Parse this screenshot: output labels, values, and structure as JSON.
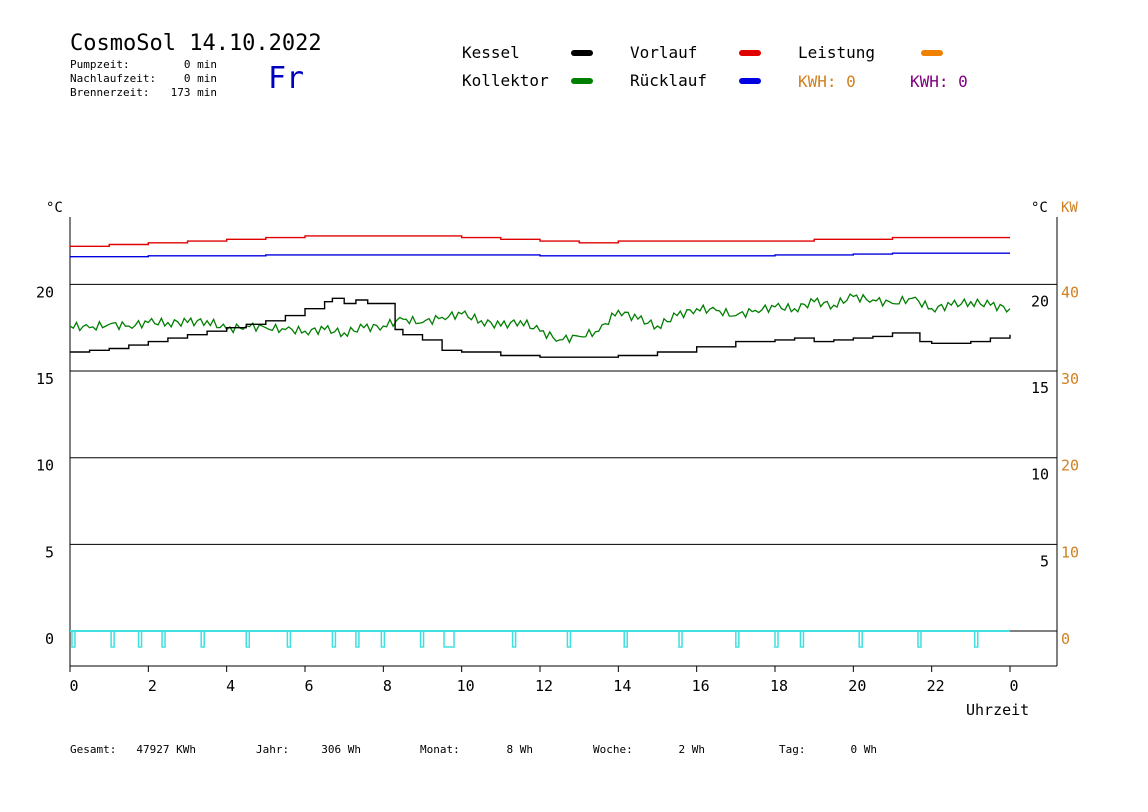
{
  "header": {
    "title": "CosmoSol 14.10.2022",
    "weekday": "Fr",
    "stats": [
      {
        "label": "Pumpzeit:",
        "value": "0 min"
      },
      {
        "label": "Nachlaufzeit:",
        "value": "0 min"
      },
      {
        "label": "Brennerzeit:",
        "value": "173 min"
      }
    ]
  },
  "legend": [
    {
      "label": "Kessel",
      "color": "#000000"
    },
    {
      "label": "Kollektor",
      "color": "#007f00"
    },
    {
      "label": "Vorlauf",
      "color": "#e00000"
    },
    {
      "label": "Rücklauf",
      "color": "#0000e0"
    },
    {
      "label": "Leistung",
      "color": "#f08000"
    }
  ],
  "kwh": [
    {
      "text": "KWH: 0",
      "color": "#d08020"
    },
    {
      "text": "KWH: 0",
      "color": "#800080"
    }
  ],
  "axis_units": {
    "left": "°C",
    "right_temp": "°C",
    "right_power": "KW"
  },
  "footer": [
    {
      "label": "Gesamt:",
      "value": "47927 KWh"
    },
    {
      "label": "Jahr:",
      "value": "306 Wh"
    },
    {
      "label": "Monat:",
      "value": "8 Wh"
    },
    {
      "label": "Woche:",
      "value": "2 Wh"
    },
    {
      "label": "Tag:",
      "value": "0 Wh"
    }
  ],
  "chart_data": {
    "type": "line",
    "xlabel": "Uhrzeit",
    "x_ticks": [
      "0",
      "2",
      "4",
      "6",
      "8",
      "10",
      "12",
      "14",
      "16",
      "18",
      "20",
      "22",
      "0"
    ],
    "xlim": [
      0,
      24
    ],
    "ylim": [
      -2,
      24
    ],
    "left_ticks": [
      "0",
      "5",
      "10",
      "15",
      "20"
    ],
    "left_tick_values": [
      0,
      5,
      10,
      15,
      20
    ],
    "right_temp_ticks": [
      "5",
      "10",
      "15",
      "20"
    ],
    "right_temp_values": [
      5,
      10,
      15,
      20
    ],
    "power_ticks": [
      "0",
      "10",
      "20",
      "30",
      "40"
    ],
    "power_tick_values": [
      0,
      10,
      20,
      30,
      40
    ],
    "grid": true,
    "series": [
      {
        "name": "Vorlauf",
        "color": "#e00000",
        "x": [
          0,
          1,
          2,
          3,
          4,
          5,
          6,
          7,
          8,
          9,
          10,
          11,
          12,
          13,
          14,
          15,
          16,
          17,
          18,
          19,
          20,
          21,
          22,
          23,
          24
        ],
        "y": [
          22.2,
          22.3,
          22.4,
          22.5,
          22.6,
          22.7,
          22.8,
          22.8,
          22.8,
          22.8,
          22.7,
          22.6,
          22.5,
          22.4,
          22.5,
          22.5,
          22.5,
          22.5,
          22.5,
          22.6,
          22.6,
          22.7,
          22.7,
          22.7,
          22.7
        ]
      },
      {
        "name": "Rücklauf",
        "color": "#0000e0",
        "x": [
          0,
          1,
          2,
          3,
          4,
          5,
          6,
          7,
          8,
          9,
          10,
          11,
          12,
          13,
          14,
          15,
          16,
          17,
          18,
          19,
          20,
          21,
          22,
          23,
          24
        ],
        "y": [
          21.6,
          21.6,
          21.65,
          21.65,
          21.65,
          21.7,
          21.7,
          21.7,
          21.7,
          21.7,
          21.7,
          21.7,
          21.65,
          21.65,
          21.65,
          21.65,
          21.65,
          21.65,
          21.7,
          21.7,
          21.75,
          21.8,
          21.8,
          21.8,
          21.8
        ]
      },
      {
        "name": "Kollektor",
        "color": "#007f00",
        "x": [
          0,
          0.5,
          1,
          1.5,
          2,
          2.5,
          3,
          3.5,
          4,
          4.5,
          5,
          5.5,
          6,
          6.5,
          7,
          7.5,
          8,
          8.5,
          9,
          9.5,
          10,
          10.5,
          11,
          11.5,
          12,
          12.5,
          13,
          13.5,
          14,
          14.5,
          15,
          15.5,
          16,
          16.5,
          17,
          17.5,
          18,
          18.5,
          19,
          19.5,
          20,
          20.5,
          21,
          21.5,
          22,
          22.5,
          23,
          23.5,
          24
        ],
        "y": [
          17.6,
          17.5,
          17.7,
          17.6,
          17.8,
          17.8,
          17.8,
          17.9,
          17.4,
          17.6,
          17.5,
          17.4,
          17.3,
          17.4,
          17.2,
          17.5,
          17.6,
          18.0,
          17.8,
          18.1,
          18.3,
          17.9,
          17.6,
          17.9,
          17.3,
          16.8,
          17.0,
          17.3,
          18.5,
          18.0,
          17.6,
          18.2,
          18.6,
          18.5,
          18.2,
          18.5,
          18.7,
          18.6,
          19.0,
          18.8,
          19.3,
          19.1,
          18.9,
          19.2,
          18.6,
          18.8,
          19.0,
          18.8,
          18.6
        ]
      },
      {
        "name": "Kessel",
        "color": "#000000",
        "x": [
          0,
          0.5,
          1,
          1.5,
          2,
          2.5,
          3,
          3.5,
          4,
          4.5,
          5,
          5.5,
          6,
          6.5,
          6.7,
          7.0,
          7.3,
          7.6,
          8.0,
          8.3,
          8.5,
          9.0,
          9.5,
          10,
          11,
          12,
          12.5,
          13,
          14,
          15,
          16,
          17,
          18,
          18.5,
          19,
          19.5,
          20,
          20.5,
          21,
          21.4,
          21.7,
          22,
          22.5,
          23,
          23.5,
          24
        ],
        "y": [
          16.1,
          16.2,
          16.3,
          16.5,
          16.7,
          16.9,
          17.1,
          17.3,
          17.5,
          17.7,
          17.9,
          18.2,
          18.6,
          19.0,
          19.2,
          18.9,
          19.1,
          18.9,
          18.9,
          17.4,
          17.1,
          16.8,
          16.2,
          16.1,
          15.9,
          15.8,
          15.8,
          15.8,
          15.9,
          16.1,
          16.4,
          16.7,
          16.8,
          16.9,
          16.7,
          16.8,
          16.9,
          17.0,
          17.2,
          17.2,
          16.7,
          16.6,
          16.6,
          16.7,
          16.9,
          17.1
        ]
      }
    ],
    "pump_pulses": [
      0.05,
      1.05,
      1.75,
      2.35,
      3.35,
      4.5,
      5.55,
      6.7,
      7.3,
      7.95,
      8.95,
      9.55,
      11.3,
      12.7,
      14.15,
      15.55,
      17.0,
      18.0,
      18.65,
      20.15,
      21.65,
      23.1
    ]
  }
}
